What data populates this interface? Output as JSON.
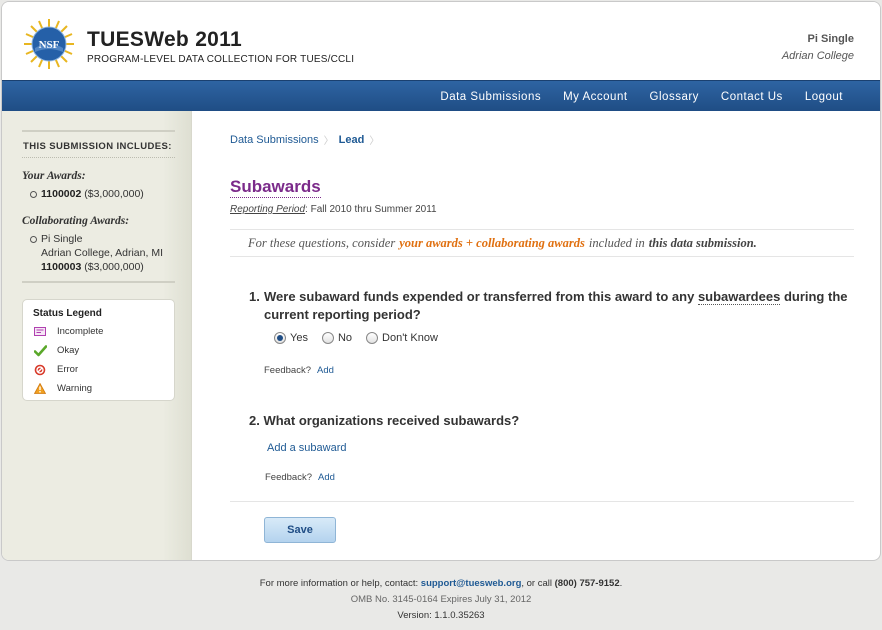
{
  "header": {
    "logo_text": "NSF",
    "title": "TUESWeb 2011",
    "subtitle": "PROGRAM-LEVEL DATA COLLECTION FOR TUES/CCLI",
    "user_name": "Pi Single",
    "user_org": "Adrian College"
  },
  "nav": {
    "items": [
      "Data Submissions",
      "My Account",
      "Glossary",
      "Contact Us",
      "Logout"
    ]
  },
  "sidebar": {
    "heading": "THIS SUBMISSION INCLUDES:",
    "your_awards_label": "Your Awards:",
    "your_awards": [
      {
        "id": "1100002",
        "amount": "($3,000,000)"
      }
    ],
    "collab_label": "Collaborating Awards:",
    "collab_awards": [
      {
        "name": "Pi Single",
        "org": "Adrian College, Adrian, MI",
        "id": "1100003",
        "amount": "($3,000,000)"
      }
    ]
  },
  "legend": {
    "title": "Status Legend",
    "items": [
      {
        "label": "Incomplete",
        "icon": "incomplete-icon"
      },
      {
        "label": "Okay",
        "icon": "check-icon"
      },
      {
        "label": "Error",
        "icon": "error-icon"
      },
      {
        "label": "Warning",
        "icon": "warning-icon"
      }
    ]
  },
  "breadcrumb": {
    "link": "Data Submissions",
    "current": "Lead"
  },
  "page": {
    "title": "Subawards",
    "period_label": "Reporting Period",
    "period_value": ": Fall 2010 thru Summer 2011",
    "consider_prefix": "For these questions, consider",
    "consider_highlight": "your awards + collaborating awards",
    "consider_mid": "included in",
    "consider_bold": "this data submission."
  },
  "q1": {
    "number": "1.",
    "text_before": "Were subaward funds expended or transferred from this award to any",
    "term": "subawardees",
    "text_after": "during the current reporting period?",
    "options": [
      "Yes",
      "No",
      "Don't Know"
    ],
    "selected": "Yes",
    "feedback_label": "Feedback?",
    "feedback_add": "Add"
  },
  "q2": {
    "number": "2.",
    "text": "What organizations received subawards?",
    "add_link": "Add a subaward",
    "feedback_label": "Feedback?",
    "feedback_add": "Add"
  },
  "save_label": "Save",
  "footer": {
    "info_prefix": "For more information or help, contact:",
    "email": "support@tuesweb.org",
    "info_mid": ", or call",
    "phone": "(800) 757-9152",
    "info_end": ".",
    "omb": "OMB No. 3145-0164 Expires July 31, 2012",
    "version": "Version: 1.1.0.35263"
  },
  "colors": {
    "nav_blue": "#1f4d85",
    "title_purple": "#7b2a8a",
    "highlight_orange": "#e07010",
    "link_blue": "#1f5a94"
  }
}
